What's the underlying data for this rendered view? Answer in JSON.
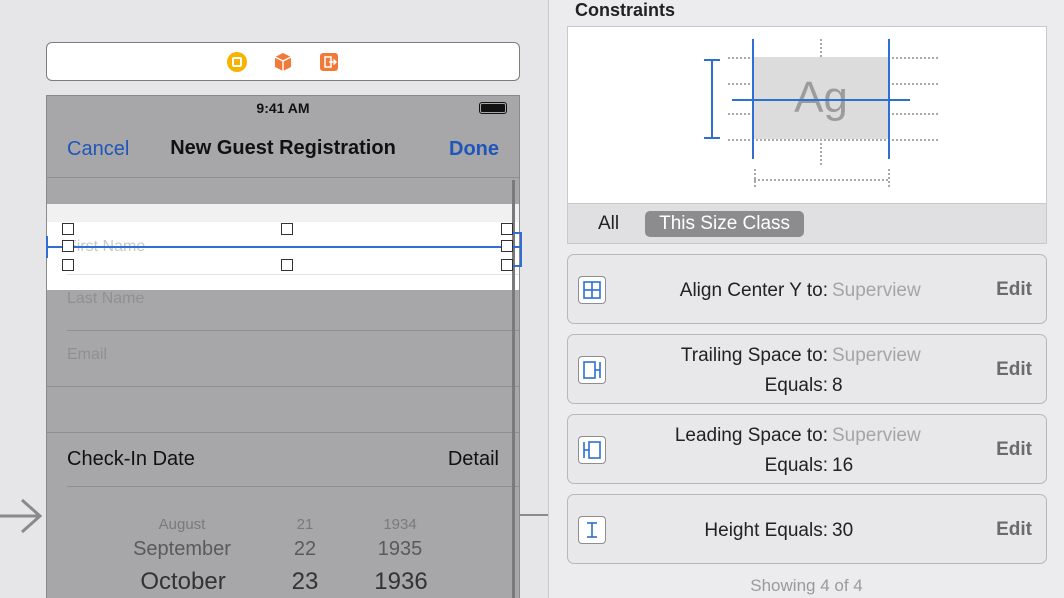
{
  "canvas": {
    "status_bar": {
      "time": "9:41 AM"
    },
    "nav_bar": {
      "cancel": "Cancel",
      "title": "New Guest Registration",
      "done": "Done"
    },
    "fields": {
      "first_name": "First Name",
      "last_name": "Last Name",
      "email": "Email"
    },
    "checkin": {
      "label": "Check-In Date",
      "detail": "Detail"
    },
    "picker": {
      "months": [
        "August",
        "September",
        "October"
      ],
      "days": [
        "21",
        "22",
        "23"
      ],
      "years": [
        "1934",
        "1935",
        "1936"
      ]
    },
    "dock_icons": [
      "view-controller-icon",
      "first-responder-icon",
      "exit-icon"
    ],
    "colors": {
      "accent": "#1f56b9",
      "constraint_blue": "#2e6fd1"
    }
  },
  "inspector": {
    "title": "Constraints",
    "preview": {
      "sample_text": "Ag"
    },
    "segments": {
      "all": "All",
      "this_size_class": "This Size Class"
    },
    "constraints": [
      {
        "icon": "align-center-y-icon",
        "label": "Align Center Y to:",
        "value": "Superview",
        "edit": "Edit"
      },
      {
        "icon": "trailing-space-icon",
        "label": "Trailing Space to:",
        "value": "Superview",
        "equals_label": "Equals:",
        "equals_value": "8",
        "edit": "Edit"
      },
      {
        "icon": "leading-space-icon",
        "label": "Leading Space to:",
        "value": "Superview",
        "equals_label": "Equals:",
        "equals_value": "16",
        "edit": "Edit"
      },
      {
        "icon": "height-icon",
        "label": "Height Equals:",
        "value": "30",
        "edit": "Edit"
      }
    ],
    "showing": "Showing 4 of 4"
  }
}
